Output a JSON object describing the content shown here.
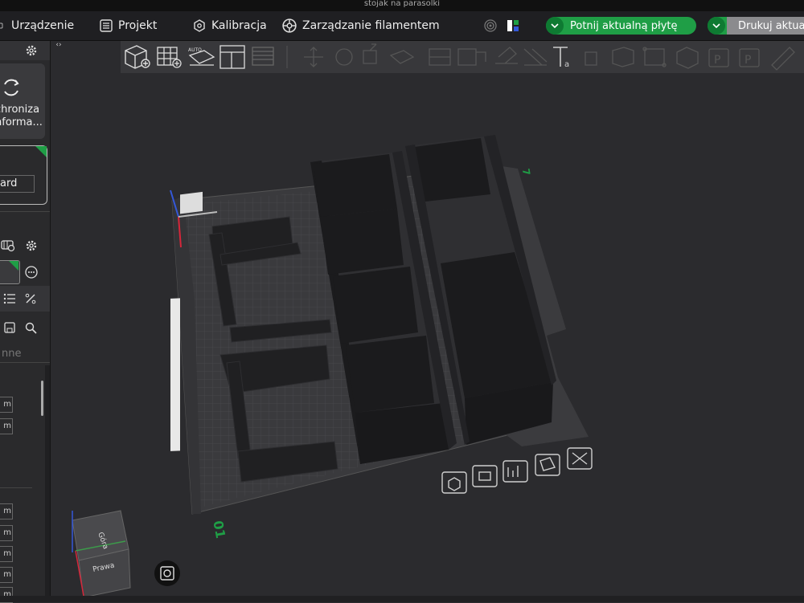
{
  "window": {
    "title": "stojak na parasolki"
  },
  "menu": {
    "items": [
      {
        "label": "Urządzenie",
        "icon": "printer-icon"
      },
      {
        "label": "Projekt",
        "icon": "list-icon"
      },
      {
        "label": "Kalibracja",
        "icon": "calibration-icon"
      },
      {
        "label": "Zarządzanie filamentem",
        "icon": "filament-icon"
      }
    ],
    "slice_button": "Potnij aktualną płytę",
    "print_button": "Drukuj aktual"
  },
  "sidebar": {
    "sync_label_1": "chroniza",
    "sync_label_2": "nforma...",
    "plate_field": "ard",
    "tab_label": "nne",
    "unit_values": [
      "m",
      "m",
      "m",
      "m",
      "m",
      "m",
      "m"
    ]
  },
  "viewport": {
    "plate_number": "01",
    "plate_marker": "7",
    "cube_top": "Góra",
    "cube_right": "Prawa",
    "accent_color": "#1f9e46",
    "x_axis_color": "#d6263a",
    "y_axis_color": "#3c9b4a",
    "z_axis_color": "#3458d8"
  }
}
